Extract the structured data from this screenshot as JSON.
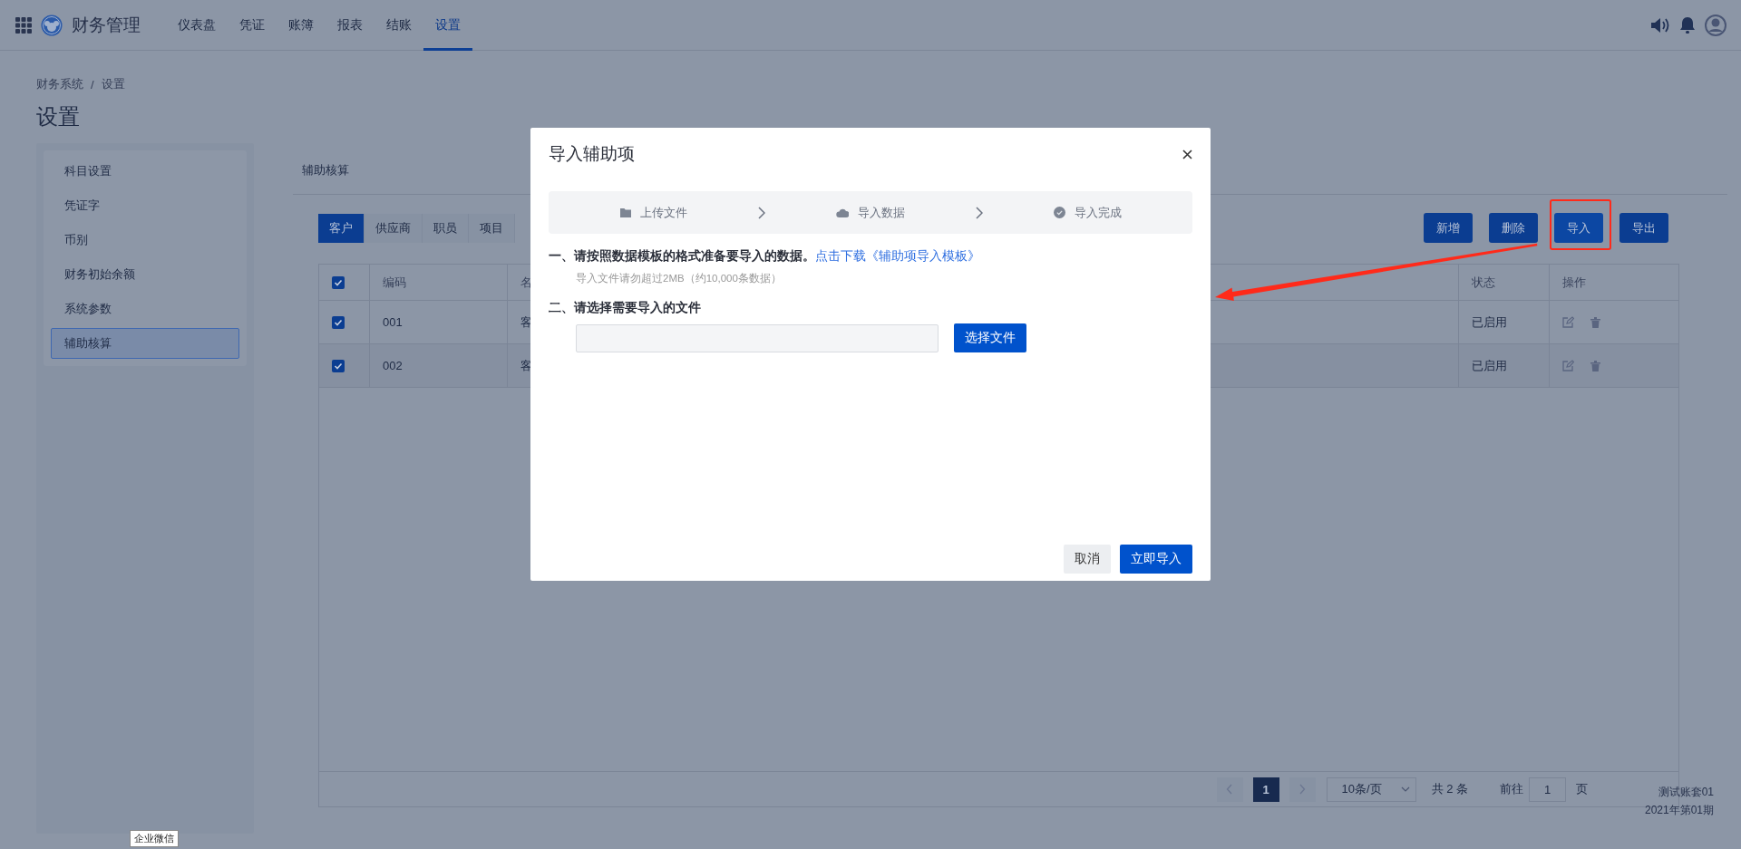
{
  "header": {
    "app_title": "财务管理",
    "nav": [
      {
        "label": "仪表盘",
        "selected": false
      },
      {
        "label": "凭证",
        "selected": false
      },
      {
        "label": "账簿",
        "selected": false
      },
      {
        "label": "报表",
        "selected": false
      },
      {
        "label": "结账",
        "selected": false
      },
      {
        "label": "设置",
        "selected": true
      }
    ]
  },
  "breadcrumb": {
    "items": [
      "财务系统",
      "设置"
    ],
    "separator": "/"
  },
  "page_title": "设置",
  "sidebar": {
    "items": [
      {
        "label": "科目设置",
        "selected": false
      },
      {
        "label": "凭证字",
        "selected": false
      },
      {
        "label": "币别",
        "selected": false
      },
      {
        "label": "财务初始余额",
        "selected": false
      },
      {
        "label": "系统参数",
        "selected": false
      },
      {
        "label": "辅助核算",
        "selected": true
      }
    ]
  },
  "section_title": "辅助核算",
  "tabs": [
    {
      "label": "客户",
      "selected": true
    },
    {
      "label": "供应商",
      "selected": false
    },
    {
      "label": "职员",
      "selected": false
    },
    {
      "label": "项目",
      "selected": false
    }
  ],
  "toolbar": [
    {
      "label": "新增",
      "annotated": false
    },
    {
      "label": "删除",
      "annotated": false
    },
    {
      "label": "导入",
      "annotated": true
    },
    {
      "label": "导出",
      "annotated": false
    }
  ],
  "table": {
    "all_checked": true,
    "columns": [
      "编码",
      "名",
      "状态",
      "操作"
    ],
    "rows": [
      {
        "checked": true,
        "code": "001",
        "name": "客",
        "status": "已启用"
      },
      {
        "checked": true,
        "code": "002",
        "name": "客",
        "status": "已启用"
      }
    ]
  },
  "pagination": {
    "current": "1",
    "page_size": "10条/页",
    "total": "共 2 条",
    "goto_label": "前往",
    "goto_value": "1",
    "page_unit": "页"
  },
  "account": {
    "name": "测试账套01",
    "period": "2021年第01期"
  },
  "tooltip": "企业微信",
  "dialog": {
    "title": "导入辅助项",
    "steps": [
      {
        "label": "上传文件",
        "kind": "upload"
      },
      {
        "label": "导入数据",
        "kind": "cloud"
      },
      {
        "label": "导入完成",
        "kind": "done"
      }
    ],
    "instruction": "一、请按照数据模板的格式准备要导入的数据。",
    "template_link": "点击下载《辅助项导入模板》",
    "note": "导入文件请勿超过2MB（约10,000条数据）",
    "file_prompt": "二、请选择需要导入的文件",
    "choose_button": "选择文件",
    "buttons": [
      {
        "label": "取消",
        "kind": "secondary"
      },
      {
        "label": "立即导入",
        "kind": "primary"
      }
    ]
  }
}
